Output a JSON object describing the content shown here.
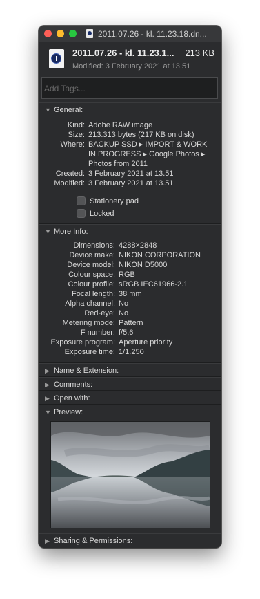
{
  "window": {
    "title": "2011.07.26 - kl. 11.23.18.dn..."
  },
  "header": {
    "file_name": "2011.07.26 - kl. 11.23.1...",
    "file_size": "213 KB",
    "modified_line": "Modified: 3 February 2021 at 13.51"
  },
  "tags": {
    "placeholder": "Add Tags..."
  },
  "general": {
    "title": "General:",
    "rows": [
      {
        "key": "Kind:",
        "value": "Adobe RAW image"
      },
      {
        "key": "Size:",
        "value": "213.313 bytes (217 KB on disk)"
      },
      {
        "key": "Where:",
        "value_lines": [
          "BACKUP SSD ▸ IMPORT & WORK",
          "IN PROGRESS ▸ Google Photos ▸",
          "Photos from 2011"
        ]
      },
      {
        "key": "Created:",
        "value": "3 February 2021 at 13.51"
      },
      {
        "key": "Modified:",
        "value": "3 February 2021 at 13.51"
      }
    ],
    "stationery": "Stationery pad",
    "locked": "Locked"
  },
  "more_info": {
    "title": "More Info:",
    "rows": [
      {
        "key": "Dimensions:",
        "value": "4288×2848"
      },
      {
        "key": "Device make:",
        "value": "NIKON CORPORATION"
      },
      {
        "key": "Device model:",
        "value": "NIKON D5000"
      },
      {
        "key": "Colour space:",
        "value": "RGB"
      },
      {
        "key": "Colour profile:",
        "value": "sRGB IEC61966-2.1"
      },
      {
        "key": "Focal length:",
        "value": "38 mm"
      },
      {
        "key": "Alpha channel:",
        "value": "No"
      },
      {
        "key": "Red-eye:",
        "value": "No"
      },
      {
        "key": "Metering mode:",
        "value": "Pattern"
      },
      {
        "key": "F number:",
        "value": "f/5,6"
      },
      {
        "key": "Exposure program:",
        "value": "Aperture priority"
      },
      {
        "key": "Exposure time:",
        "value": "1/1.250"
      }
    ]
  },
  "sections": {
    "name_ext": "Name & Extension:",
    "comments": "Comments:",
    "open_with": "Open with:",
    "preview": "Preview:",
    "sharing": "Sharing & Permissions:"
  },
  "icons": {
    "expanded": "▼",
    "collapsed": "▶"
  },
  "colors": {
    "window_bg": "#2b2c2e",
    "close": "#fe5f57",
    "minimize": "#febc2e",
    "maximize": "#28c840"
  }
}
